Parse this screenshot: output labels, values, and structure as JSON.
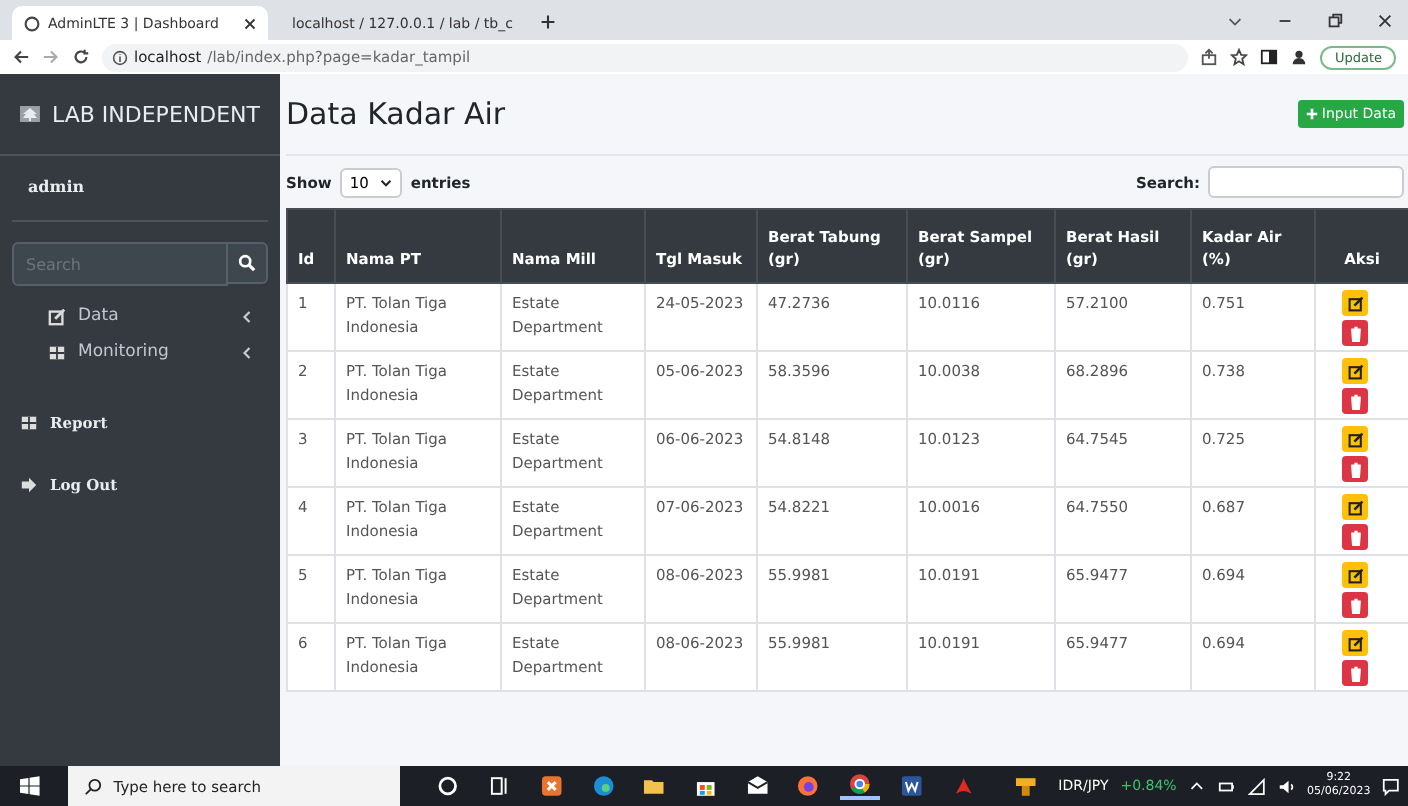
{
  "browser": {
    "tabs": [
      {
        "title": "AdminLTE 3 | Dashboard",
        "selected": true
      },
      {
        "title": "localhost / 127.0.0.1 / lab / tb_c",
        "selected": false
      }
    ],
    "url_host": "localhost",
    "url_path": "/lab/index.php?page=kadar_tampil",
    "update_button": "Update"
  },
  "sidebar": {
    "brand": "LAB INDEPENDENT",
    "user": "admin",
    "search": {
      "placeholder": "Search"
    },
    "items": [
      {
        "label": "Data",
        "kind": "tree"
      },
      {
        "label": "Monitoring",
        "kind": "tree"
      },
      {
        "label": "Report",
        "kind": "link"
      },
      {
        "label": "Log Out",
        "kind": "link"
      }
    ]
  },
  "page": {
    "title": "Data Kadar Air",
    "add_button": "Input Data",
    "show_label": "Show",
    "page_size": "10",
    "entries_label": "entries",
    "search_label": "Search:"
  },
  "table": {
    "columns": [
      "Id",
      "Nama PT",
      "Nama Mill",
      "Tgl Masuk",
      "Berat Tabung (gr)",
      "Berat Sampel (gr)",
      "Berat Hasil (gr)",
      "Kadar Air (%)",
      "Aksi"
    ],
    "rows": [
      [
        "1",
        "PT. Tolan Tiga Indonesia",
        "Estate Department",
        "24-05-2023",
        "47.2736",
        "10.0116",
        "57.2100",
        "0.751"
      ],
      [
        "2",
        "PT. Tolan Tiga Indonesia",
        "Estate Department",
        "05-06-2023",
        "58.3596",
        "10.0038",
        "68.2896",
        "0.738"
      ],
      [
        "3",
        "PT. Tolan Tiga Indonesia",
        "Estate Department",
        "06-06-2023",
        "54.8148",
        "10.0123",
        "64.7545",
        "0.725"
      ],
      [
        "4",
        "PT. Tolan Tiga Indonesia",
        "Estate Department",
        "07-06-2023",
        "54.8221",
        "10.0016",
        "64.7550",
        "0.687"
      ],
      [
        "5",
        "PT. Tolan Tiga Indonesia",
        "Estate Department",
        "08-06-2023",
        "55.9981",
        "10.0191",
        "65.9477",
        "0.694"
      ],
      [
        "6",
        "PT. Tolan Tiga Indonesia",
        "Estate Department",
        "08-06-2023",
        "55.9981",
        "10.0191",
        "65.9477",
        "0.694"
      ]
    ]
  },
  "taskbar": {
    "search_placeholder": "Type here to search",
    "ticker": "IDR/JPY",
    "change": "+0.84%",
    "time": "9:22",
    "date": "05/06/2023"
  }
}
